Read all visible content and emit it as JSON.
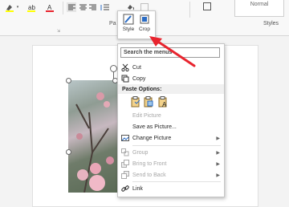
{
  "ribbon": {
    "paragraph_label": "Pa",
    "styles_label": "Styles",
    "normal_style": "Normal"
  },
  "mini_toolbar": {
    "style_label": "Style",
    "crop_label": "Crop"
  },
  "context_menu": {
    "search_placeholder": "Search the menus",
    "items": [
      {
        "label": "Cut",
        "enabled": true
      },
      {
        "label": "Copy",
        "enabled": true
      },
      {
        "label": "Paste Options:",
        "header": true
      },
      {
        "label": "Edit Picture",
        "enabled": false
      },
      {
        "label": "Save as Picture...",
        "enabled": true
      },
      {
        "label": "Change Picture",
        "enabled": true,
        "submenu": true
      },
      {
        "label": "Group",
        "enabled": false,
        "submenu": true
      },
      {
        "label": "Bring to Front",
        "enabled": false,
        "submenu": true
      },
      {
        "label": "Send to Back",
        "enabled": false,
        "submenu": true
      },
      {
        "label": "Link",
        "enabled": true
      }
    ]
  },
  "colors": {
    "arrow": "#e8242e",
    "font_color_underline": "#e8242e",
    "highlight_underline": "#ffff00"
  }
}
